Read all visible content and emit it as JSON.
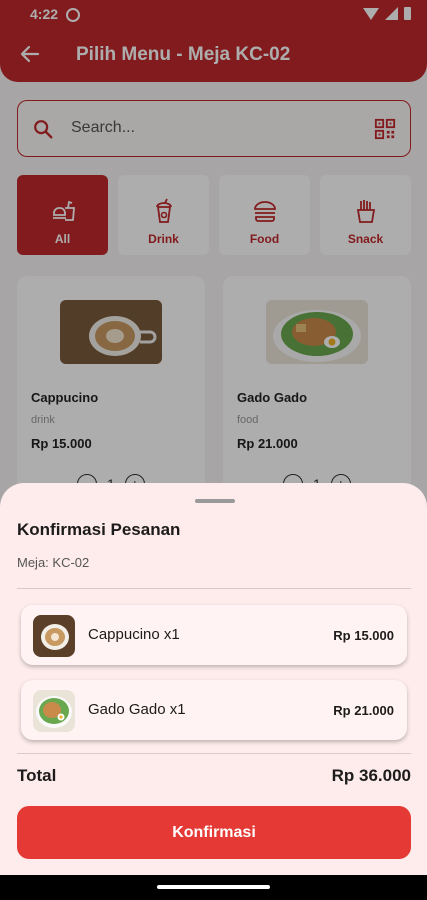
{
  "status": {
    "time": "4:22"
  },
  "header": {
    "title": "Pilih Menu - Meja KC-02"
  },
  "search": {
    "placeholder": "Search..."
  },
  "categories": [
    {
      "label": "All",
      "icon": "fastfood-icon",
      "active": true
    },
    {
      "label": "Drink",
      "icon": "cup-icon",
      "active": false
    },
    {
      "label": "Food",
      "icon": "burger-icon",
      "active": false
    },
    {
      "label": "Snack",
      "icon": "fries-icon",
      "active": false
    }
  ],
  "products": [
    {
      "name": "Cappucino",
      "category": "drink",
      "price": "Rp 15.000",
      "qty": "1"
    },
    {
      "name": "Gado Gado",
      "category": "food",
      "price": "Rp 21.000",
      "qty": "1"
    }
  ],
  "sheet": {
    "title": "Konfirmasi Pesanan",
    "table": "Meja: KC-02",
    "items": [
      {
        "name": "Cappucino x1",
        "price": "Rp 15.000"
      },
      {
        "name": "Gado Gado x1",
        "price": "Rp 21.000"
      }
    ],
    "total_label": "Total",
    "total_value": "Rp 36.000",
    "confirm_label": "Konfirmasi"
  },
  "colors": {
    "primary": "#c0282b",
    "button": "#e53935",
    "sheet": "#fdeceb"
  }
}
